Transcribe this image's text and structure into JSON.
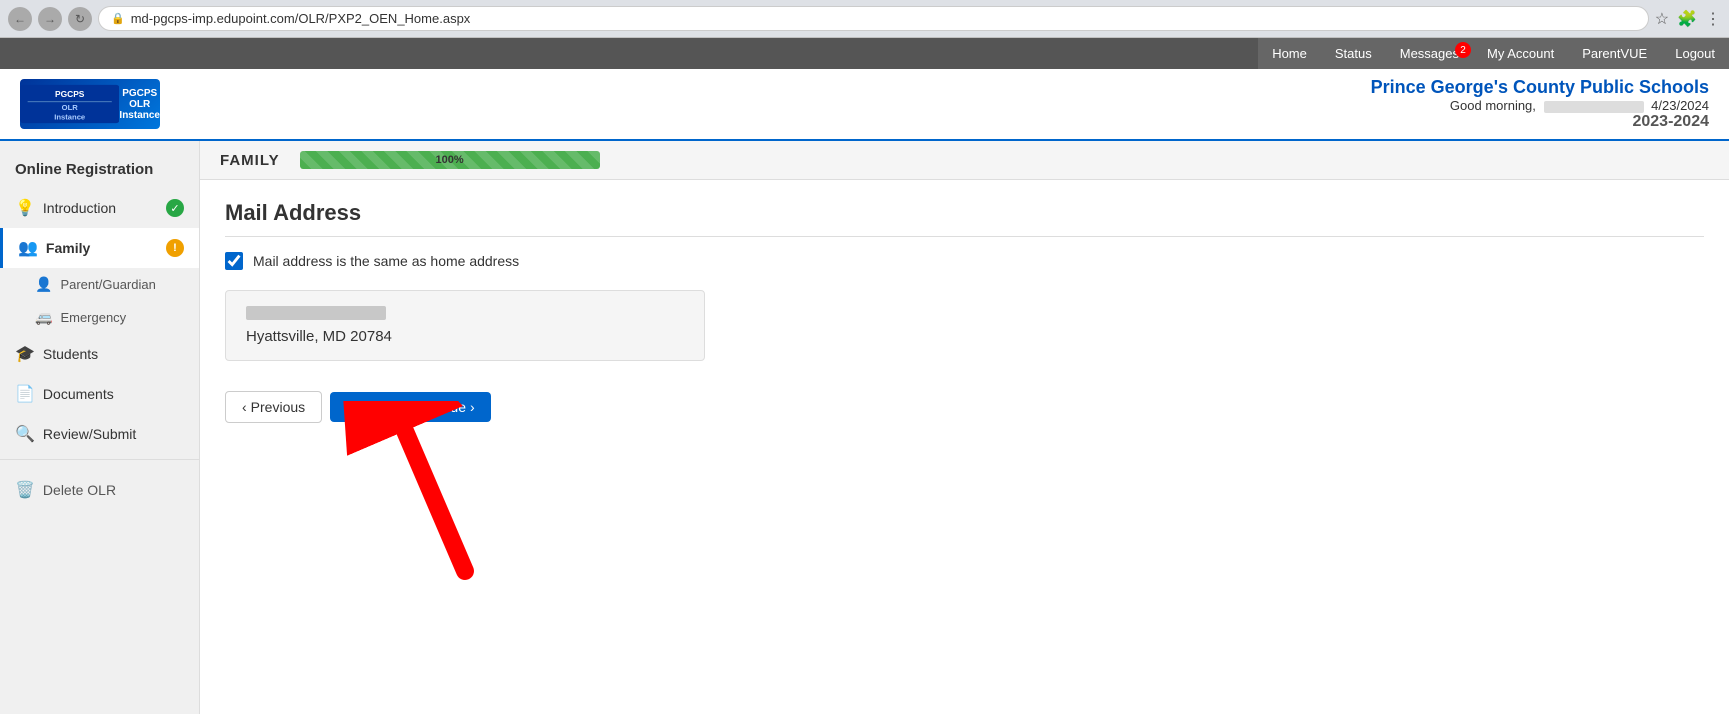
{
  "browser": {
    "url": "md-pgcps-imp.edupoint.com/OLR/PXP2_OEN_Home.aspx"
  },
  "topnav": {
    "home": "Home",
    "status": "Status",
    "messages": "Messages",
    "messages_badge": "2",
    "my_account": "My Account",
    "parentvue": "ParentVUE",
    "logout": "Logout"
  },
  "header": {
    "school_name": "Prince George's County Public Schools",
    "greeting": "Good morning,",
    "date": "4/23/2024",
    "year": "2023-2024"
  },
  "sidebar": {
    "title": "Online Registration",
    "items": [
      {
        "id": "introduction",
        "label": "Introduction",
        "icon": "💡",
        "badge": "✓",
        "badge_type": "green",
        "active": false
      },
      {
        "id": "family",
        "label": "Family",
        "icon": "👥",
        "badge": "!",
        "badge_type": "orange",
        "active": true
      },
      {
        "id": "parent-guardian",
        "label": "Parent/Guardian",
        "icon": "👤",
        "sub": true
      },
      {
        "id": "emergency",
        "label": "Emergency",
        "icon": "🚐",
        "sub": true
      },
      {
        "id": "students",
        "label": "Students",
        "icon": "🎓",
        "sub": false
      },
      {
        "id": "documents",
        "label": "Documents",
        "icon": "📄",
        "sub": false
      },
      {
        "id": "review-submit",
        "label": "Review/Submit",
        "icon": "🔍",
        "sub": false
      }
    ],
    "delete_label": "Delete OLR"
  },
  "section": {
    "title": "FAMILY",
    "progress": 100,
    "progress_label": "100%"
  },
  "content": {
    "page_title": "Mail Address",
    "checkbox_label": "Mail address is the same as home address",
    "checkbox_checked": true,
    "address_city_state_zip": "Hyattsville, MD 20784"
  },
  "buttons": {
    "previous": "Previous",
    "save_continue": "Save And Continue"
  }
}
